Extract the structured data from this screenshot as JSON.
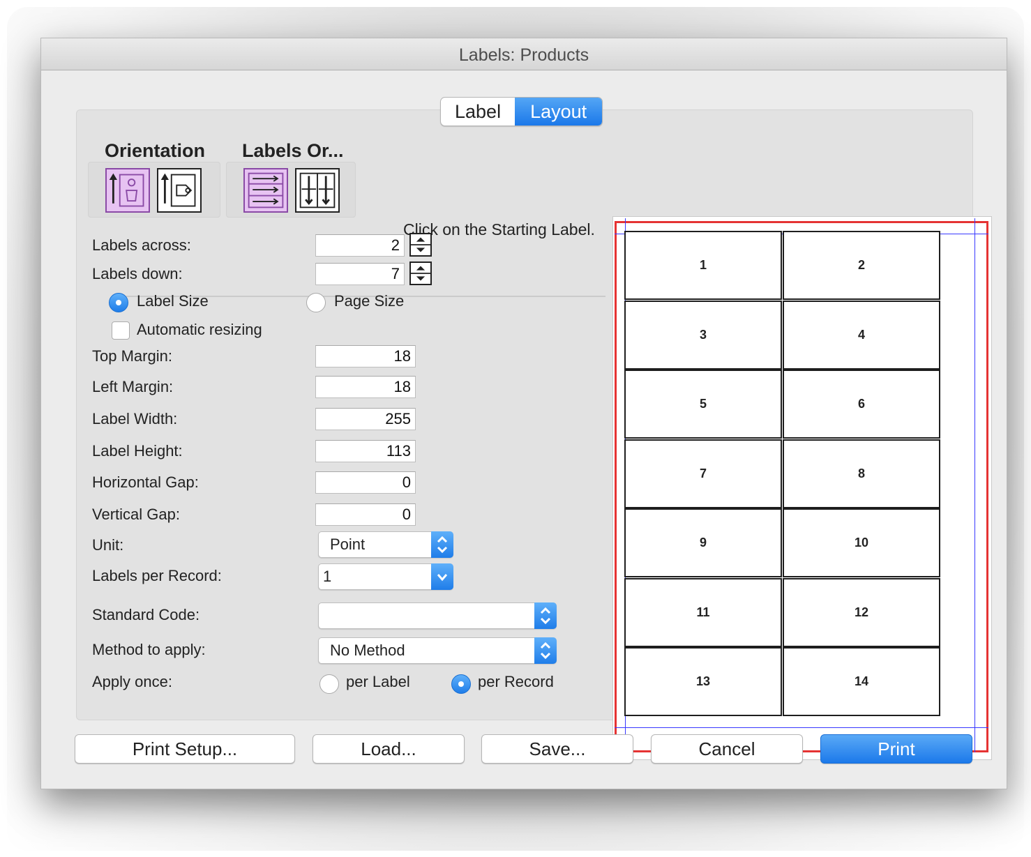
{
  "window": {
    "title": "Labels: Products"
  },
  "tabs": [
    {
      "label": "Label",
      "active": false
    },
    {
      "label": "Layout",
      "active": true
    }
  ],
  "orientation": {
    "heading": "Orientation",
    "options": [
      "portrait-orientation-icon",
      "landscape-orientation-icon"
    ],
    "selected": 0
  },
  "labels_order": {
    "heading": "Labels Or...",
    "options": [
      "order-across-icon",
      "order-down-icon"
    ],
    "selected": 0
  },
  "preview": {
    "hint": "Click on the Starting Label.",
    "labels": [
      "1",
      "2",
      "3",
      "4",
      "5",
      "6",
      "7",
      "8",
      "9",
      "10",
      "11",
      "12",
      "13",
      "14"
    ]
  },
  "form": {
    "labels_across": {
      "label": "Labels across:",
      "value": "2"
    },
    "labels_down": {
      "label": "Labels down:",
      "value": "7"
    },
    "size_mode": {
      "label_size": "Label Size",
      "page_size": "Page Size",
      "selected": "label_size"
    },
    "auto_resize": {
      "label": "Automatic resizing",
      "checked": false
    },
    "top_margin": {
      "label": "Top Margin:",
      "value": "18"
    },
    "left_margin": {
      "label": "Left Margin:",
      "value": "18"
    },
    "label_width": {
      "label": "Label Width:",
      "value": "255"
    },
    "label_height": {
      "label": "Label Height:",
      "value": "113"
    },
    "horizontal_gap": {
      "label": "Horizontal Gap:",
      "value": "0"
    },
    "vertical_gap": {
      "label": "Vertical Gap:",
      "value": "0"
    },
    "unit": {
      "label": "Unit:",
      "value": "Point"
    },
    "labels_per_record": {
      "label": "Labels per Record:",
      "value": "1"
    },
    "standard_code": {
      "label": "Standard Code:",
      "value": ""
    },
    "method": {
      "label": "Method to apply:",
      "value": "No Method"
    },
    "apply_once": {
      "label": "Apply once:",
      "per_label": "per Label",
      "per_record": "per Record",
      "selected": "per_record"
    }
  },
  "buttons": {
    "print_setup": "Print Setup...",
    "load": "Load...",
    "save": "Save...",
    "cancel": "Cancel",
    "print": "Print"
  },
  "colors": {
    "accent": "#1f7de9",
    "selected_icon": "#e7c3f2",
    "margin_frame": "#e53333",
    "guide_lines": "#3838ff"
  }
}
